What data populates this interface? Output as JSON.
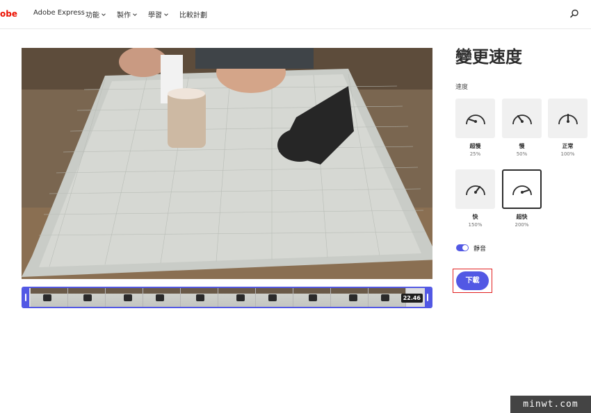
{
  "header": {
    "brand_fragment": "obe",
    "brand": "Adobe Express",
    "nav": [
      {
        "label": "功能",
        "has_menu": true
      },
      {
        "label": "製作",
        "has_menu": true
      },
      {
        "label": "學習",
        "has_menu": true
      },
      {
        "label": "比較計劃",
        "has_menu": false
      }
    ],
    "search_icon": "search-icon"
  },
  "editor": {
    "video_preview": "video-preview",
    "timeline": {
      "duration": "22.46",
      "frame_count": 10
    }
  },
  "panel": {
    "title": "變更速度",
    "speed_label": "速度",
    "options": [
      {
        "name": "超慢",
        "percent": "25%",
        "icon": "speedometer-very-slow-icon",
        "selected": false
      },
      {
        "name": "慢",
        "percent": "50%",
        "icon": "speedometer-slow-icon",
        "selected": false
      },
      {
        "name": "正常",
        "percent": "100%",
        "icon": "speedometer-normal-icon",
        "selected": false
      },
      {
        "name": "快",
        "percent": "150%",
        "icon": "speedometer-fast-icon",
        "selected": false
      },
      {
        "name": "超快",
        "percent": "200%",
        "icon": "speedometer-very-fast-icon",
        "selected": true
      }
    ],
    "mute": {
      "label": "靜音",
      "on": true
    },
    "download_label": "下載"
  },
  "watermark": "minwt.com",
  "colors": {
    "accent": "#5258e4",
    "brand_red": "#eb1000",
    "highlight_box": "#e11e1e"
  }
}
